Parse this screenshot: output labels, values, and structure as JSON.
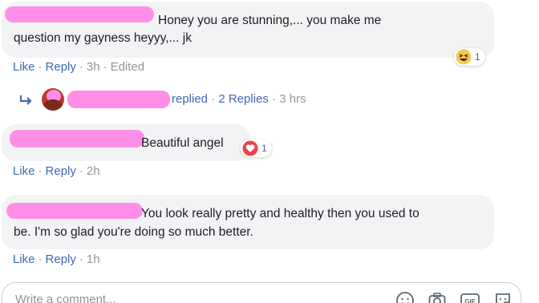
{
  "comments": [
    {
      "text_line1": "Honey you are stunning,... you make me",
      "text_line2": "question my gayness heyyy,... jk",
      "actions": {
        "like": "Like",
        "reply": "Reply",
        "time": "3h",
        "edited": "Edited"
      },
      "reaction": {
        "icon": "haha-emoji-icon",
        "count": "1"
      },
      "replies_summary": {
        "replied": "replied",
        "count_label": "2 Replies",
        "time": "3 hrs"
      }
    },
    {
      "text": "Beautiful angel",
      "actions": {
        "like": "Like",
        "reply": "Reply",
        "time": "2h"
      },
      "reaction": {
        "icon": "love-heart-icon",
        "count": "1"
      }
    },
    {
      "text_line1": "You look really pretty and healthy then you used to",
      "text_line2": "be. I'm so glad you're doing so much better.",
      "actions": {
        "like": "Like",
        "reply": "Reply",
        "time": "1h"
      }
    }
  ],
  "composer": {
    "placeholder": "Write a comment...",
    "icons": [
      "emoji-icon",
      "camera-icon",
      "gif-icon",
      "sticker-icon"
    ]
  },
  "colors": {
    "link_blue": "#4267b2",
    "meta_grey": "#90949c",
    "bubble_bg": "#f2f3f5",
    "redaction_pink": "#ff8fe6",
    "love_red": "#e9434f",
    "haha_yellow": "#f7c94b"
  }
}
